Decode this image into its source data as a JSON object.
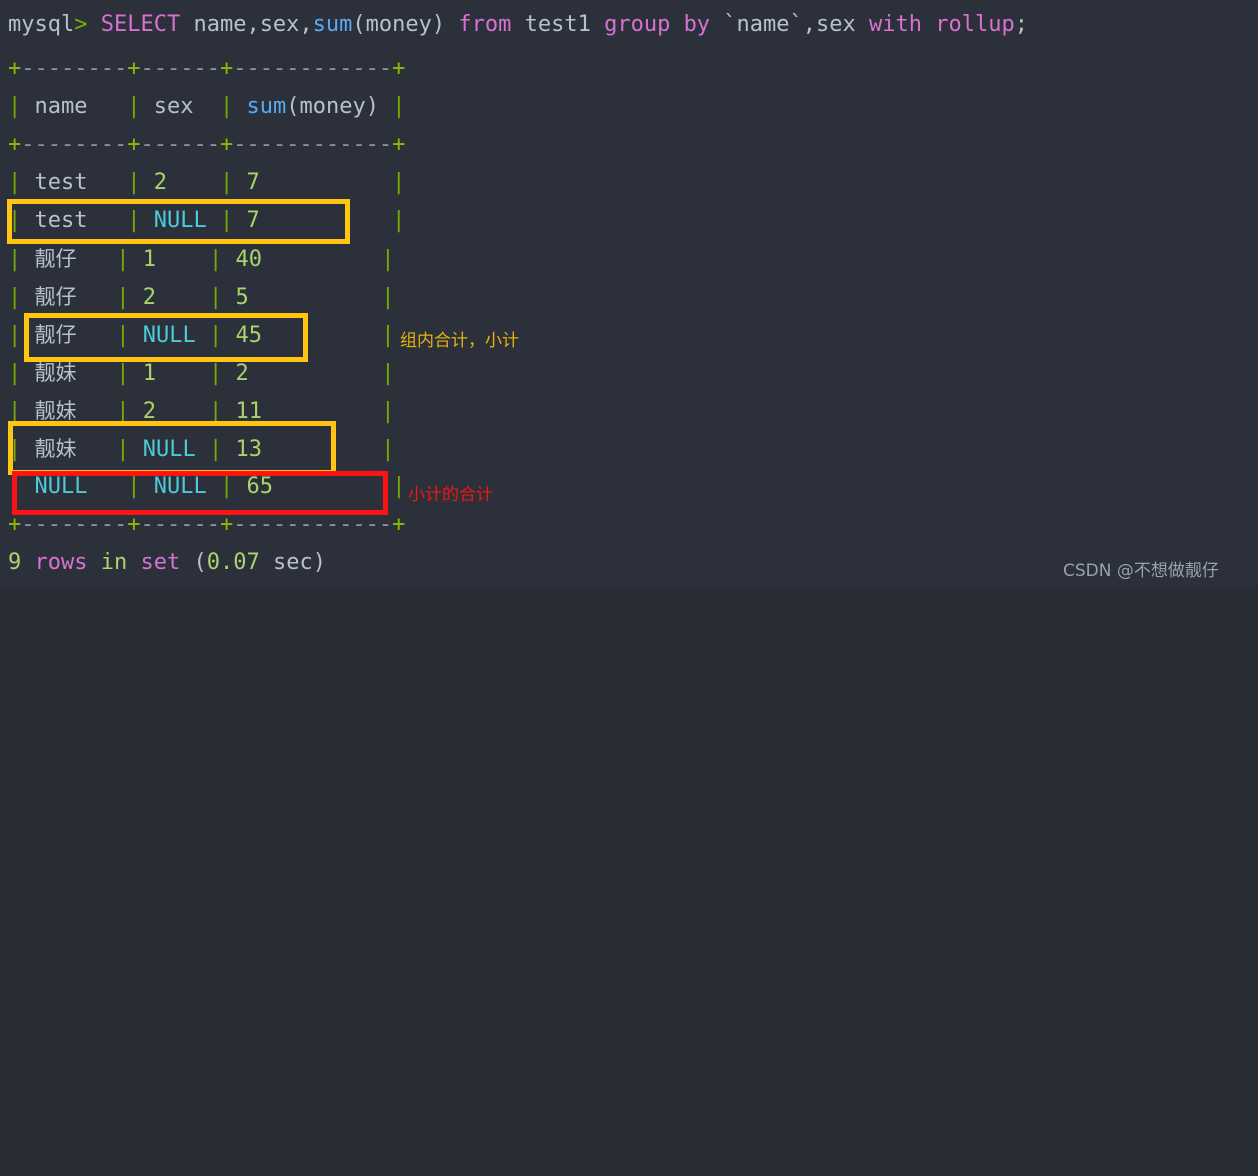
{
  "terminal": {
    "prompt": "mysql",
    "prompt_arrow": ">",
    "query": {
      "keyword_select": "SELECT",
      "select_list_a": " name,sex,",
      "func_sum": "sum",
      "func_args": "(money)",
      "keyword_from": " from",
      "table": " test1 ",
      "keyword_group_by": "group by",
      "group_cols": " `name`,sex ",
      "keyword_with_rollup": "with rollup",
      "terminator": ";",
      "full_text": "mysql> SELECT name,sex,sum(money) from test1 group by `name`,sex with rollup;"
    },
    "border_plus": "+",
    "border_top": "+--------+------+------------+",
    "border_mid": "+--------+------+------------+",
    "border_bottom": "+--------+------+------------+",
    "columns": [
      "name",
      "sex",
      "sum(money)"
    ],
    "header_row": "| name   | sex  | sum(money) |",
    "rows": [
      {
        "name": "test",
        "sex": "2",
        "money": "7",
        "name_is_cjk": false,
        "sex_is_null": false
      },
      {
        "name": "test",
        "sex": "NULL",
        "money": "7",
        "name_is_cjk": false,
        "sex_is_null": true
      },
      {
        "name": "靓仔",
        "sex": "1",
        "money": "40",
        "name_is_cjk": true,
        "sex_is_null": false
      },
      {
        "name": "靓仔",
        "sex": "2",
        "money": "5",
        "name_is_cjk": true,
        "sex_is_null": false
      },
      {
        "name": "靓仔",
        "sex": "NULL",
        "money": "45",
        "name_is_cjk": true,
        "sex_is_null": true
      },
      {
        "name": "靓妹",
        "sex": "1",
        "money": "2",
        "name_is_cjk": true,
        "sex_is_null": false
      },
      {
        "name": "靓妹",
        "sex": "2",
        "money": "11",
        "name_is_cjk": true,
        "sex_is_null": false
      },
      {
        "name": "靓妹",
        "sex": "NULL",
        "money": "13",
        "name_is_cjk": true,
        "sex_is_null": true
      },
      {
        "name": "NULL",
        "sex": "NULL",
        "money": "65",
        "name_is_cjk": false,
        "sex_is_null": true
      }
    ],
    "footer": {
      "count": "9",
      "rows_word": " rows ",
      "in_word": "in",
      "set_word": " set ",
      "paren_open": "(",
      "time": "0.07",
      "sec_word": " sec",
      "paren_close": ")",
      "full_text": "9 rows in set (0.07 sec)"
    }
  },
  "annotations": {
    "subtotal_label": "组内合计，小计",
    "grandtotal_label": "小计的合计",
    "box_color_yellow": "#ffc512",
    "box_color_red": "#fb1414"
  },
  "watermark": {
    "text": "CSDN @不想做靓仔"
  }
}
